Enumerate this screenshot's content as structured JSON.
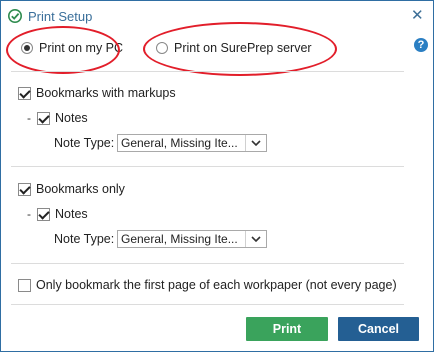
{
  "window": {
    "title": "Print Setup",
    "close_glyph": "✕",
    "help_glyph": "?"
  },
  "print_target": {
    "options": [
      {
        "label": "Print on my PC",
        "selected": true
      },
      {
        "label": "Print on SurePrep server",
        "selected": false
      }
    ]
  },
  "bookmarks_with_markups": {
    "label": "Bookmarks with markups",
    "checked": true,
    "notes": {
      "dash": "-",
      "label": "Notes",
      "checked": true
    },
    "note_type": {
      "label": "Note Type:",
      "value": "General, Missing Ite..."
    }
  },
  "bookmarks_only": {
    "label": "Bookmarks only",
    "checked": true,
    "notes": {
      "dash": "-",
      "label": "Notes",
      "checked": true
    },
    "note_type": {
      "label": "Note Type:",
      "value": "General, Missing Ite..."
    }
  },
  "first_page_only": {
    "label": "Only bookmark the first page of each workpaper (not every page)",
    "checked": false
  },
  "buttons": {
    "print": "Print",
    "cancel": "Cancel"
  },
  "colors": {
    "accent_blue": "#245f93",
    "print_green": "#3aa35c",
    "annotation_red": "#e21e2a"
  },
  "icons": {
    "app": "green-check-icon",
    "help": "help-icon",
    "close": "close-icon",
    "dropdown": "chevron-down-icon"
  }
}
